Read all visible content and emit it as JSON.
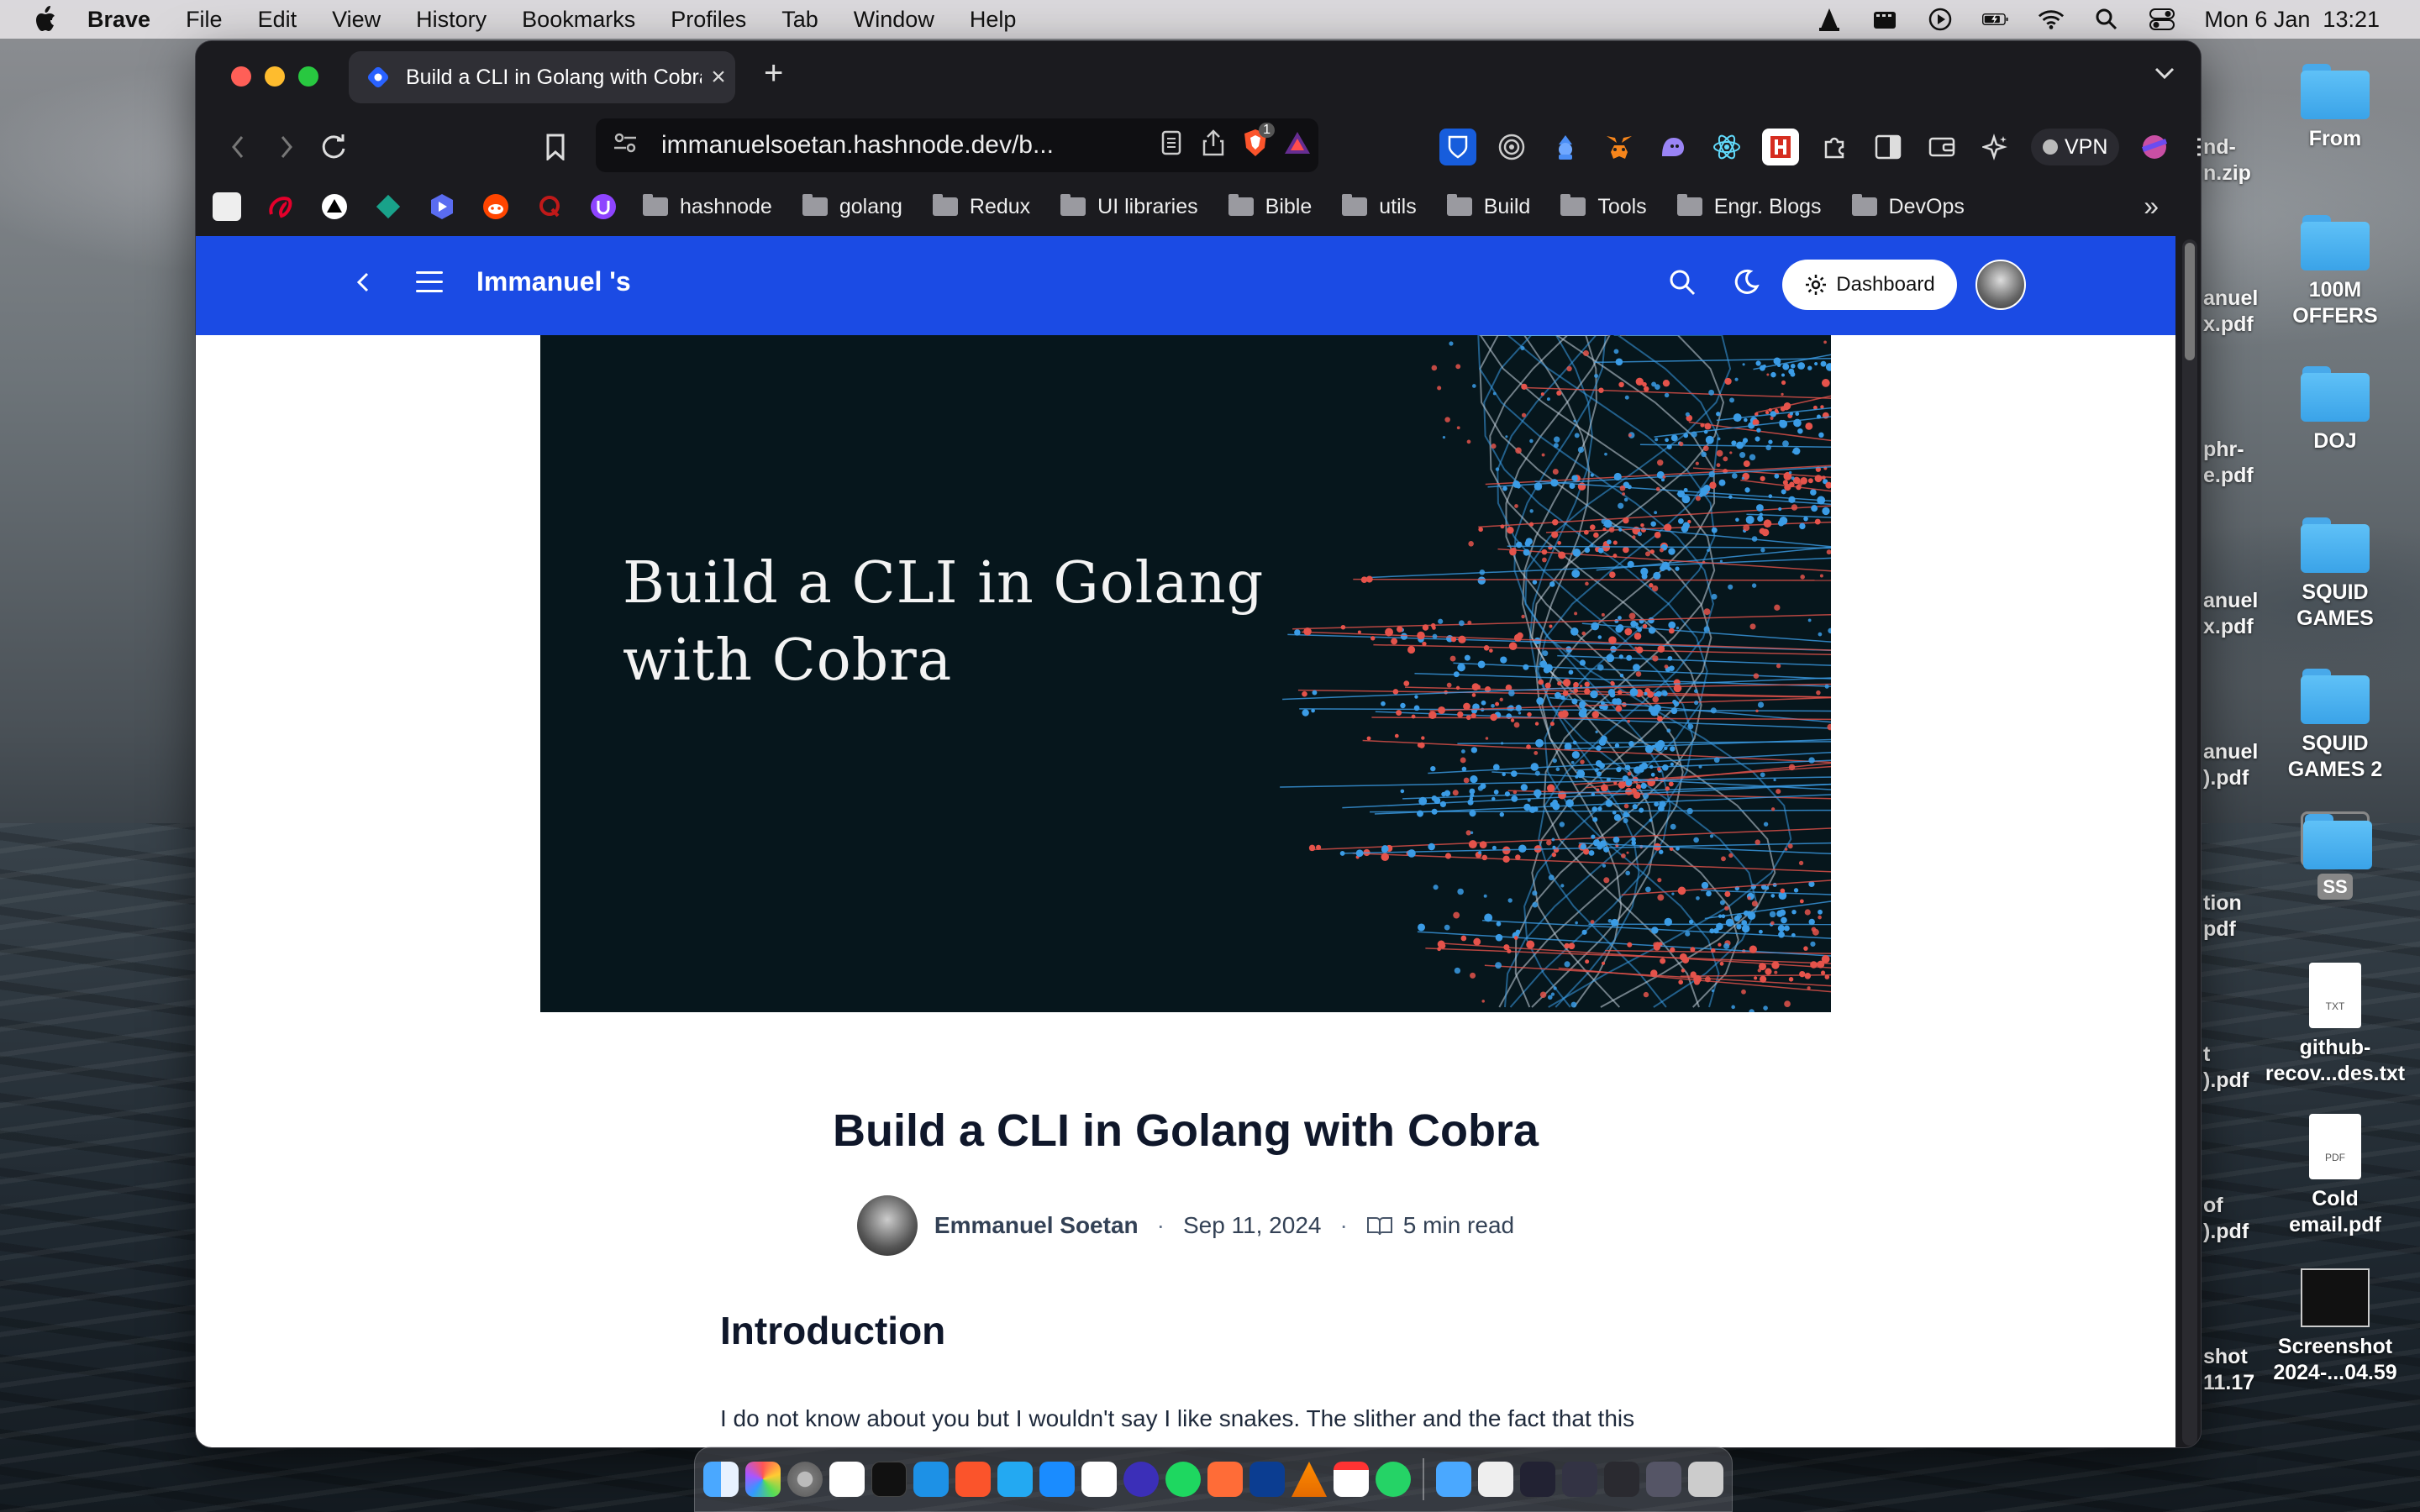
{
  "menubar": {
    "app_name": "Brave",
    "menus": [
      "File",
      "Edit",
      "View",
      "History",
      "Bookmarks",
      "Profiles",
      "Tab",
      "Window",
      "Help"
    ],
    "clock": "Mon 6 Jan  13:21"
  },
  "desktop": {
    "items": [
      {
        "label": "From",
        "kind": "folder"
      },
      {
        "label": "100M OFFERS",
        "kind": "folder"
      },
      {
        "label": "DOJ",
        "kind": "folder"
      },
      {
        "label": "SQUID GAMES",
        "kind": "folder"
      },
      {
        "label": "SQUID GAMES 2",
        "kind": "folder"
      },
      {
        "label": "SS",
        "kind": "folder"
      },
      {
        "label": "github-recov...des.txt",
        "kind": "txt",
        "badge": "TXT"
      },
      {
        "label": "Cold email.pdf",
        "kind": "pdf",
        "badge": "PDF"
      },
      {
        "label": "Screenshot 2024-...04.59",
        "kind": "screenshot"
      }
    ],
    "partial_labels": [
      "nd-",
      "n.zip",
      "anuel",
      "x.pdf",
      "phr-",
      "e.pdf",
      "anuel",
      "x.pdf",
      "anuel",
      ").pdf",
      "tion",
      "pdf",
      "t",
      ").pdf",
      "of",
      ").pdf",
      "shot",
      "11.17"
    ]
  },
  "browser": {
    "tab_title": "Build a CLI in Golang with Cobra",
    "url": "immanuelsoetan.hashnode.dev/b...",
    "shields_count": "1",
    "vpn_label": "VPN",
    "bookmarks": [
      "hashnode",
      "golang",
      "Redux",
      "UI libraries",
      "Bible",
      "utils",
      "Build",
      "Tools",
      "Engr. Blogs",
      "DevOps"
    ]
  },
  "blog": {
    "name": "Immanuel 's",
    "dashboard_label": "Dashboard",
    "cover_title_line1": "Build a CLI in Golang",
    "cover_title_line2": "with Cobra",
    "post_title": "Build a CLI in Golang with Cobra",
    "author": "Emmanuel Soetan",
    "date": "Sep 11, 2024",
    "read_time": "5 min read",
    "section_heading": "Introduction",
    "paragraph": "I do not know about you but I wouldn't say I like snakes. The slither and the fact that this belly-crawling reptile can pack venom to kill you just terrifies me."
  },
  "colors": {
    "blog_header": "#1b4be4",
    "cover_bg": "#06161c",
    "accent_red": "#e5534b",
    "accent_blue": "#3b9ce6"
  }
}
